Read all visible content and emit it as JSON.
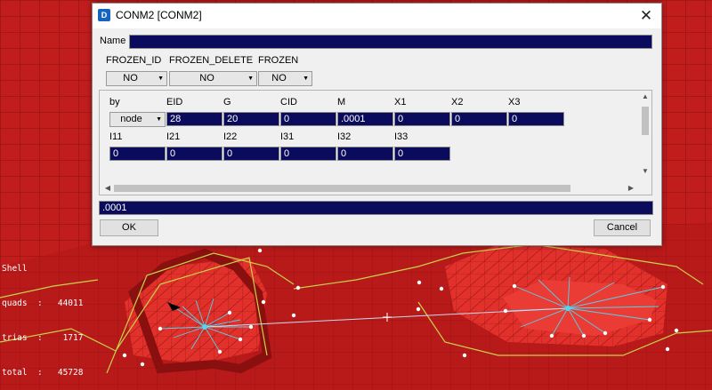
{
  "dialog": {
    "title": "CONM2 [CONM2]",
    "app_icon_text": "D",
    "close_glyph": "✕",
    "name_label": "Name",
    "name_value": "",
    "flags": [
      {
        "label": "FROZEN_ID",
        "value": "NO"
      },
      {
        "label": "FROZEN_DELETE",
        "value": "NO"
      },
      {
        "label": "FROZEN",
        "value": "NO"
      }
    ],
    "row1_headers": [
      "by",
      "EID",
      "G",
      "CID",
      "M",
      "X1",
      "X2",
      "X3"
    ],
    "by_value": "node",
    "row1_values": [
      "28",
      "20",
      "0",
      ".0001",
      "0",
      "0",
      "0"
    ],
    "row2_headers": [
      "I11",
      "I21",
      "I22",
      "I31",
      "I32",
      "I33"
    ],
    "row2_values": [
      "0",
      "0",
      "0",
      "0",
      "0",
      "0"
    ],
    "edit_value": ".0001",
    "ok_label": "OK",
    "cancel_label": "Cancel"
  },
  "stats": {
    "title": "Shell",
    "rows": [
      {
        "label": "quads",
        "value": "44011"
      },
      {
        "label": "trias",
        "value": "1717"
      },
      {
        "label": "total",
        "value": "45728"
      }
    ]
  },
  "colors": {
    "mesh_red": "#c21d1d",
    "field_navy": "#0b0b5e",
    "edge_yellow": "#c8d24a",
    "spider_cyan": "#55d0e8"
  }
}
